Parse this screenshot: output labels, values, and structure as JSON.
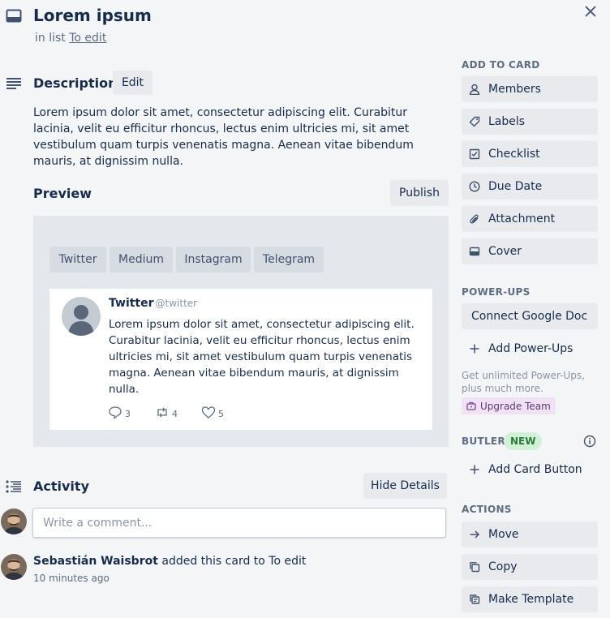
{
  "card": {
    "title": "Lorem ipsum",
    "in_list_prefix": "in list",
    "list_name": "To edit"
  },
  "description": {
    "title": "Description",
    "edit_label": "Edit",
    "text": "Lorem ipsum dolor sit amet, consectetur adipiscing elit. Curabitur lacinia, velit eu efficitur rhoncus, lectus enim ultricies mi, sit amet vestibulum quam turpis venenatis magna. Aenean vitae bibendum mauris, at dignissim nulla."
  },
  "preview": {
    "title": "Preview",
    "publish_label": "Publish",
    "tabs": [
      "Twitter",
      "Medium",
      "Instagram",
      "Telegram"
    ],
    "tweet": {
      "name": "Twitter",
      "handle": "@twitter",
      "text": "Lorem ipsum dolor sit amet, consectetur adipiscing elit. Curabitur lacinia, velit eu efficitur rhoncus, lectus enim ultricies mi, sit amet vestibulum quam turpis venenatis magna. Aenean vitae bibendum mauris, at dignissim nulla.",
      "replies": "3",
      "retweets": "4",
      "likes": "5"
    }
  },
  "activity": {
    "title": "Activity",
    "hide_details_label": "Hide Details",
    "comment_placeholder": "Write a comment...",
    "entry": {
      "user": "Sebastián Waisbrot",
      "action": "added this card to To edit",
      "time": "10 minutes ago"
    }
  },
  "sidebar": {
    "add_to_card": {
      "label": "ADD TO CARD",
      "items": [
        "Members",
        "Labels",
        "Checklist",
        "Due Date",
        "Attachment",
        "Cover"
      ]
    },
    "power_ups": {
      "label": "POWER-UPS",
      "connect_label": "Connect Google Doc",
      "add_label": "Add Power-Ups",
      "upsell_text": "Get unlimited Power-Ups, plus much more.",
      "upgrade_label": "Upgrade Team"
    },
    "butler": {
      "label": "BUTLER",
      "badge": "NEW",
      "add_button_label": "Add Card Button"
    },
    "actions": {
      "label": "ACTIONS",
      "items": [
        "Move",
        "Copy",
        "Make Template"
      ]
    }
  },
  "colors": {
    "background": "#f4f5f7",
    "button": "#e8eaee",
    "text": "#172b4d",
    "muted": "#5e6c84",
    "new_badge_bg": "#d3f1d6",
    "upgrade_bg": "#f0e1f5"
  }
}
